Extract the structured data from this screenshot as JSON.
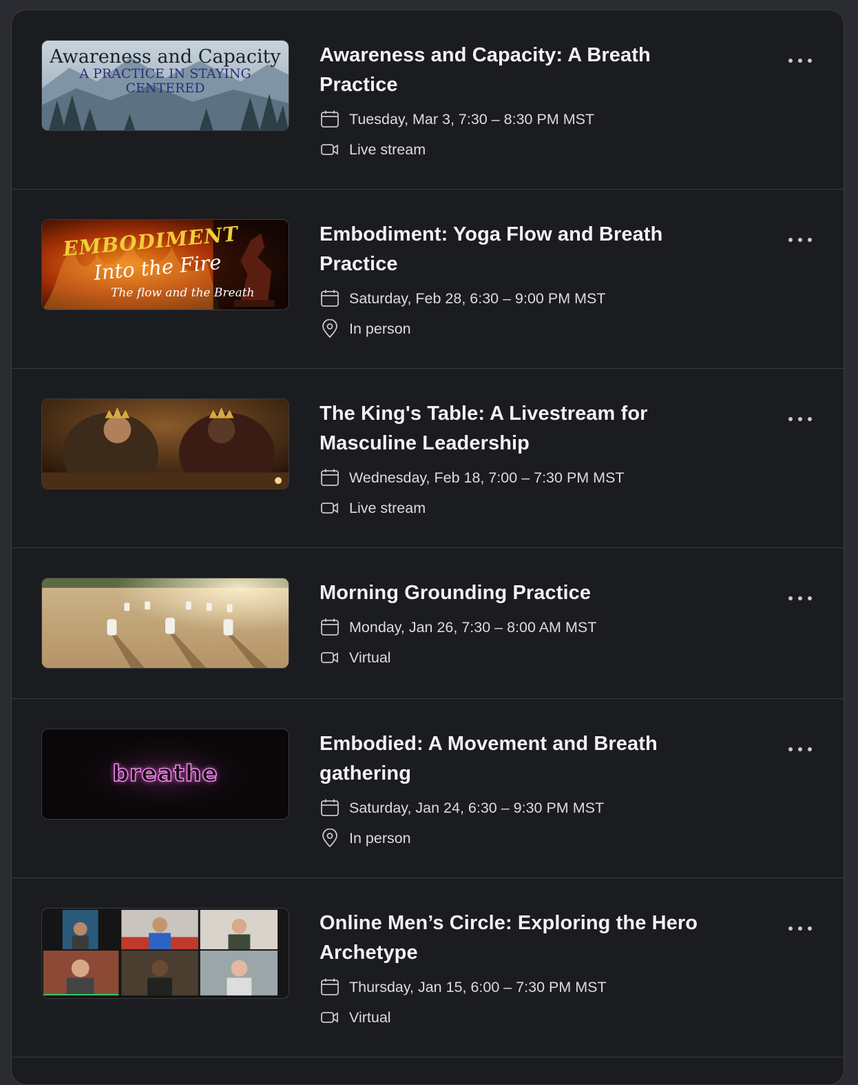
{
  "events": [
    {
      "title": "Awareness and Capacity: A Breath Practice",
      "date": "Tuesday, Mar 3, 7:30 – 8:30 PM MST",
      "location": "Live stream",
      "location_icon": "video-icon",
      "image_text": [
        "Awareness and Capacity",
        "A PRACTICE IN STAYING",
        "CENTERED"
      ]
    },
    {
      "title": "Embodiment: Yoga Flow and Breath Practice",
      "date": "Saturday, Feb 28, 6:30 – 9:00 PM MST",
      "location": "In person",
      "location_icon": "map-pin-icon",
      "image_text": [
        "EMBODIMENT",
        "Into the Fire",
        "The flow and the Breath"
      ]
    },
    {
      "title": "The King's Table: A Livestream for Masculine Leadership",
      "date": "Wednesday, Feb 18, 7:00 – 7:30 PM MST",
      "location": "Live stream",
      "location_icon": "video-icon"
    },
    {
      "title": "Morning Grounding Practice",
      "date": "Monday, Jan 26, 7:30 – 8:00 AM MST",
      "location": "Virtual",
      "location_icon": "video-icon"
    },
    {
      "title": "Embodied: A Movement and Breath gathering",
      "date": "Saturday, Jan 24, 6:30 – 9:30 PM MST",
      "location": "In person",
      "location_icon": "map-pin-icon",
      "image_text": [
        "breathe"
      ]
    },
    {
      "title": "Online Men’s Circle: Exploring the Hero Archetype",
      "date": "Thursday, Jan 15, 6:00 – 7:30 PM MST",
      "location": "Virtual",
      "location_icon": "video-icon"
    }
  ],
  "colors": {
    "page_bg": "#2b2c31",
    "panel_bg": "#1b1c20",
    "divider": "#393a40",
    "title": "#f2f2f4",
    "meta": "#dcdce0"
  }
}
